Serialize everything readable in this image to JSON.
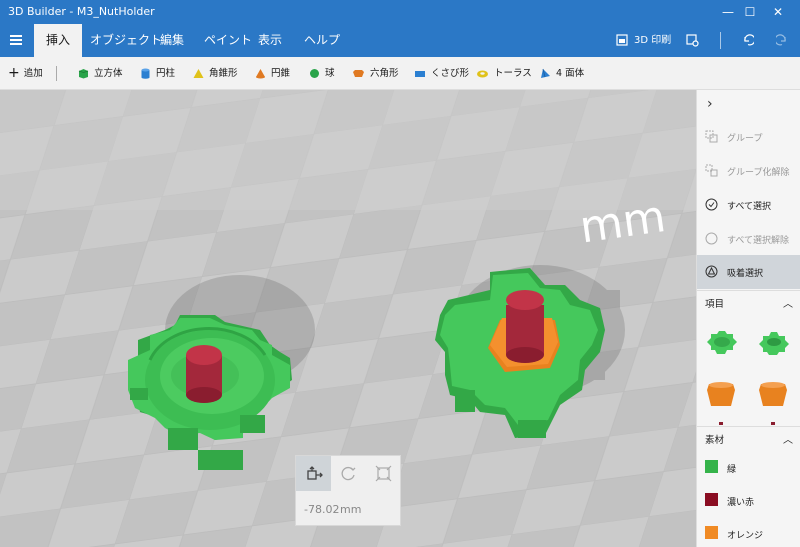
{
  "window": {
    "title": "3D Builder - M3_NutHolder",
    "controls": {
      "minimize": "—",
      "maximize": "☐",
      "close": "✕"
    }
  },
  "menu": {
    "tabs": [
      {
        "label": "挿入",
        "active": true
      },
      {
        "label": "オブジェクト",
        "active": false
      },
      {
        "label": "編集",
        "active": false
      },
      {
        "label": "ペイント",
        "active": false
      },
      {
        "label": "表示",
        "active": false
      },
      {
        "label": "ヘルプ",
        "active": false
      }
    ],
    "print_label": "3D 印刷"
  },
  "toolbar": {
    "add_label": "追加",
    "shapes": [
      {
        "label": "立方体",
        "icon": "cube-icon",
        "color": "#2aa44a"
      },
      {
        "label": "円柱",
        "icon": "cylinder-icon",
        "color": "#2b7fd1"
      },
      {
        "label": "角錐形",
        "icon": "pyramid-icon",
        "color": "#e0c21a"
      },
      {
        "label": "円錐",
        "icon": "cone-icon",
        "color": "#e07a22"
      },
      {
        "label": "球",
        "icon": "sphere-icon",
        "color": "#2aa44a"
      },
      {
        "label": "六角形",
        "icon": "hexagon-icon",
        "color": "#e07a22"
      },
      {
        "label": "くさび形",
        "icon": "wedge-icon",
        "color": "#2b7fd1"
      },
      {
        "label": "トーラス",
        "icon": "torus-icon",
        "color": "#e0c21a"
      },
      {
        "label": "4 面体",
        "icon": "tetrahedron-icon",
        "color": "#2b7fd1"
      }
    ]
  },
  "viewport": {
    "unit_overlay": "mm",
    "value": "-78.02",
    "unit": "mm"
  },
  "right_panel": {
    "actions": [
      {
        "label": "グループ",
        "icon": "group-icon",
        "state": "disabled"
      },
      {
        "label": "グループ化解除",
        "icon": "ungroup-icon",
        "state": "disabled"
      },
      {
        "label": "すべて選択",
        "icon": "select-all-icon",
        "state": "normal"
      },
      {
        "label": "すべて選択解除",
        "icon": "deselect-all-icon",
        "state": "disabled"
      },
      {
        "label": "吸着選択",
        "icon": "snap-select-icon",
        "state": "active"
      }
    ],
    "items_header": "項目",
    "materials_header": "素材",
    "materials": [
      {
        "label": "緑",
        "color": "#35b34a"
      },
      {
        "label": "濃い赤",
        "color": "#8a0d22"
      },
      {
        "label": "オレンジ",
        "color": "#f08a24"
      }
    ]
  },
  "colors": {
    "accent": "#2b78c6",
    "gear_green": "#45c85c",
    "nut_orange": "#f4902e",
    "bolt_red": "#a3283b"
  }
}
